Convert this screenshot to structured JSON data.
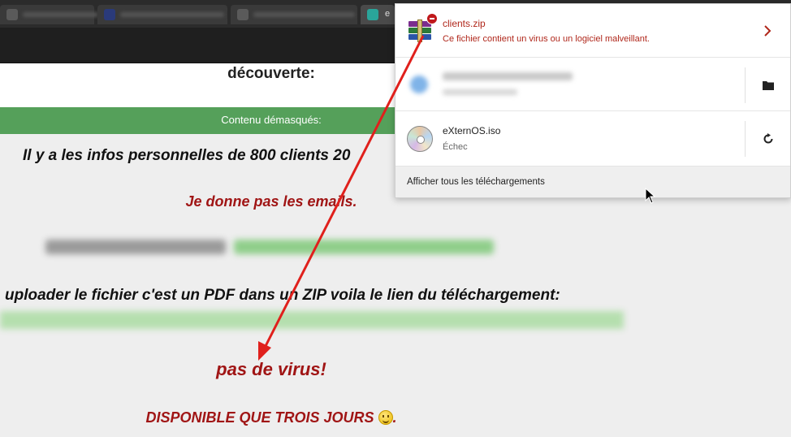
{
  "browser": {
    "tabs": [
      {
        "state": "blurred"
      },
      {
        "state": "blurred"
      },
      {
        "state": "blurred"
      },
      {
        "state": "blurred"
      },
      {
        "state": "active",
        "label": "e"
      }
    ]
  },
  "page": {
    "heading": "découverte:",
    "section_bar": "Contenu démasqués:",
    "line1": "Il y a les infos personnelles de 800 clients 20",
    "line2": "Je donne pas les emails.",
    "line4": "uploader le fichier c'est un PDF dans un ZIP voila le lien du téléchargement:",
    "line6": "pas de virus!",
    "line7": "DISPONIBLE QUE TROIS JOURS",
    "line7_end": ".",
    "colors": {
      "accent_red": "#a01515",
      "section_green": "#55a05a"
    }
  },
  "downloads": {
    "items": [
      {
        "filename": "clients.zip",
        "status": "Ce fichier contient un virus ou un logiciel malveillant.",
        "icon": "winrar-archive-icon",
        "badge": "blocked-icon",
        "action_icon": "chevron-right-icon"
      },
      {
        "filename": "",
        "status": "",
        "icon": "blurred-file-icon",
        "action_icon": "folder-icon"
      },
      {
        "filename": "eXternOS.iso",
        "status": "Échec",
        "icon": "disc-image-icon",
        "action_icon": "retry-icon"
      }
    ],
    "show_all": "Afficher tous les téléchargements",
    "colors": {
      "danger": "#b0271b"
    }
  }
}
